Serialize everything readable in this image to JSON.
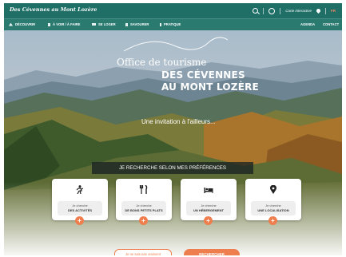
{
  "header": {
    "brand": "Des Cévennes au Mont Lozère",
    "destination_label": "Carte interactive",
    "lang": "FR"
  },
  "nav": {
    "items": [
      {
        "label": "DÉCOUVRIR",
        "icon": "mountain-icon"
      },
      {
        "label": "À VOIR / À FAIRE",
        "icon": "hiker-icon"
      },
      {
        "label": "SE LOGER",
        "icon": "bed-icon"
      },
      {
        "label": "SAVOURER",
        "icon": "cutlery-icon"
      },
      {
        "label": "PRATIQUE",
        "icon": "info-icon"
      }
    ],
    "right": [
      {
        "label": "AGENDA"
      },
      {
        "label": "CONTACT"
      }
    ]
  },
  "hero": {
    "title_line1": "Office de tourisme",
    "title_line2": "DES CÉVENNES",
    "title_line3": "AU MONT LOZÈRE",
    "tagline": "Une invitation à l'ailleurs...",
    "pref_banner": "JE RECHERCHE SELON MES PRÉFÉRENCES"
  },
  "cards": [
    {
      "l1": "Je cherche",
      "l2": "DES ACTIVITÉS",
      "icon": "hiker-icon"
    },
    {
      "l1": "Je cherche",
      "l2": "DE BONS PETITS PLATS",
      "icon": "cutlery-icon"
    },
    {
      "l1": "Je cherche",
      "l2": "UN HÉBERGEMENT",
      "icon": "bed-icon"
    },
    {
      "l1": "Je cherche",
      "l2": "UNE LOCALISATION",
      "icon": "location-pin-icon"
    }
  ],
  "actions": {
    "reset": "Je ne sais pas vraiment",
    "search": "RECHERCHER"
  },
  "colors": {
    "brand_teal": "#1f6f66",
    "accent_orange": "#ef7e4f"
  }
}
